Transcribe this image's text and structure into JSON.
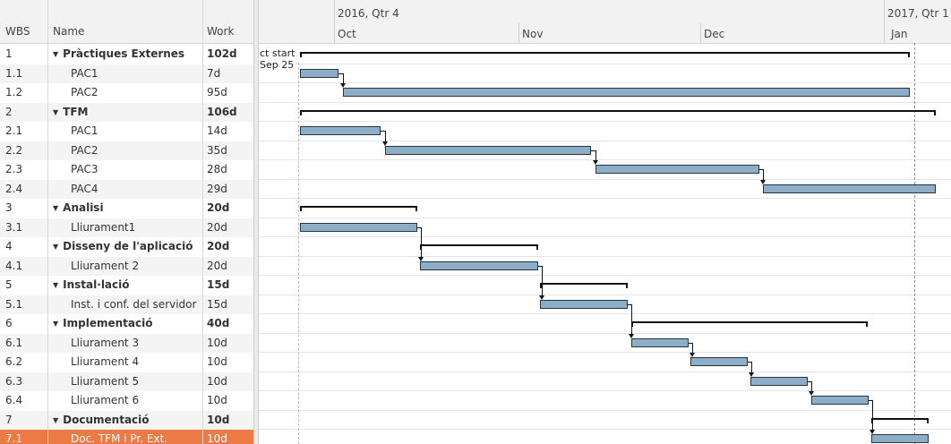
{
  "table": {
    "headers": {
      "wbs": "WBS",
      "name": "Name",
      "work": "Work"
    },
    "rows": [
      {
        "wbs": "1",
        "name": "Pràctiques Externes",
        "work": "102d",
        "summary": true
      },
      {
        "wbs": "1.1",
        "name": "PAC1",
        "work": "7d"
      },
      {
        "wbs": "1.2",
        "name": "PAC2",
        "work": "95d"
      },
      {
        "wbs": "2",
        "name": "TFM",
        "work": "106d",
        "summary": true
      },
      {
        "wbs": "2.1",
        "name": "PAC1",
        "work": "14d"
      },
      {
        "wbs": "2.2",
        "name": "PAC2",
        "work": "35d"
      },
      {
        "wbs": "2.3",
        "name": "PAC3",
        "work": "28d"
      },
      {
        "wbs": "2.4",
        "name": "PAC4",
        "work": "29d"
      },
      {
        "wbs": "3",
        "name": "Analisi",
        "work": "20d",
        "summary": true
      },
      {
        "wbs": "3.1",
        "name": "Lliurament1",
        "work": "20d"
      },
      {
        "wbs": "4",
        "name": "Disseny de l'aplicació",
        "work": "20d",
        "summary": true
      },
      {
        "wbs": "4.1",
        "name": "Lliurament 2",
        "work": "20d"
      },
      {
        "wbs": "5",
        "name": "Instal·lació",
        "work": "15d",
        "summary": true
      },
      {
        "wbs": "5.1",
        "name": "Inst. i conf. del servidor",
        "work": "15d"
      },
      {
        "wbs": "6",
        "name": "Implementació",
        "work": "40d",
        "summary": true
      },
      {
        "wbs": "6.1",
        "name": "Lliurament 3",
        "work": "10d"
      },
      {
        "wbs": "6.2",
        "name": "Lliurament 4",
        "work": "10d"
      },
      {
        "wbs": "6.3",
        "name": "Lliurament 5",
        "work": "10d"
      },
      {
        "wbs": "6.4",
        "name": "Lliurament 6",
        "work": "10d"
      },
      {
        "wbs": "7",
        "name": "Documentació",
        "work": "10d",
        "summary": true
      },
      {
        "wbs": "7.1",
        "name": "Doc. TFM i Pr. Ext.",
        "work": "10d",
        "selected": true
      }
    ]
  },
  "gantt": {
    "quarters": [
      "2016, Qtr 4",
      "2017, Qtr 1"
    ],
    "months": [
      "Oct",
      "Nov",
      "Dec",
      "Jan"
    ],
    "project_start": {
      "line1": "ct start",
      "line2": "Sep 25"
    }
  },
  "colors": {
    "bar": "#8eadc6",
    "bar_border": "#233445",
    "selected_row": "#ec7a45",
    "today_line": "#6f8fd6"
  }
}
